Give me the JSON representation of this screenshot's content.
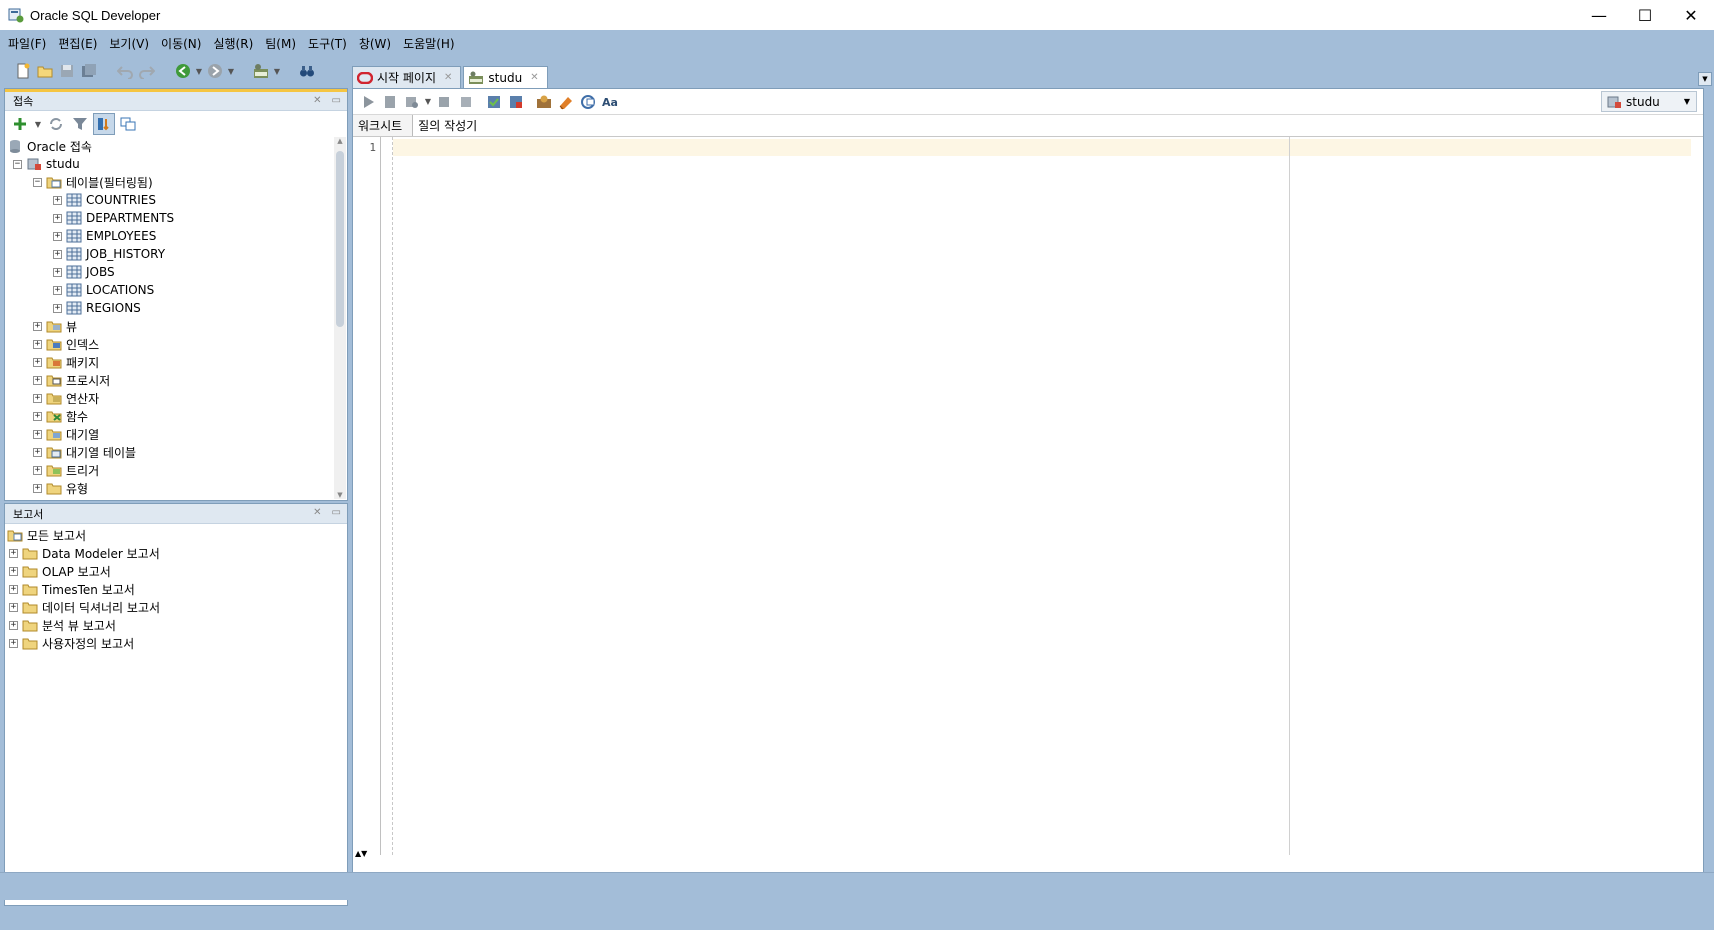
{
  "window": {
    "title": "Oracle SQL Developer",
    "minimize": "—",
    "maximize": "☐",
    "close": "✕"
  },
  "menu": [
    "파일(F)",
    "편집(E)",
    "보기(V)",
    "이동(N)",
    "실행(R)",
    "팀(M)",
    "도구(T)",
    "창(W)",
    "도움말(H)"
  ],
  "connections_panel": {
    "title": "접속",
    "root": "Oracle 접속",
    "connection": "studu",
    "tables_node": "테이블(필터링됨)",
    "tables": [
      "COUNTRIES",
      "DEPARTMENTS",
      "EMPLOYEES",
      "JOB_HISTORY",
      "JOBS",
      "LOCATIONS",
      "REGIONS"
    ],
    "object_types": [
      "뷰",
      "인덱스",
      "패키지",
      "프로시저",
      "연산자",
      "함수",
      "대기열",
      "대기열 테이블",
      "트리거",
      "유형"
    ]
  },
  "reports_panel": {
    "title": "보고서",
    "root": "모든 보고서",
    "items": [
      "Data Modeler 보고서",
      "OLAP 보고서",
      "TimesTen 보고서",
      "데이터 딕셔너리 보고서",
      "분석 뷰 보고서",
      "사용자정의 보고서"
    ]
  },
  "editor": {
    "tabs": [
      {
        "label": "시작 페이지"
      },
      {
        "label": "studu"
      }
    ],
    "connection": "studu",
    "subtabs": [
      "워크시트",
      "질의 작성기"
    ],
    "line_number": "1"
  }
}
